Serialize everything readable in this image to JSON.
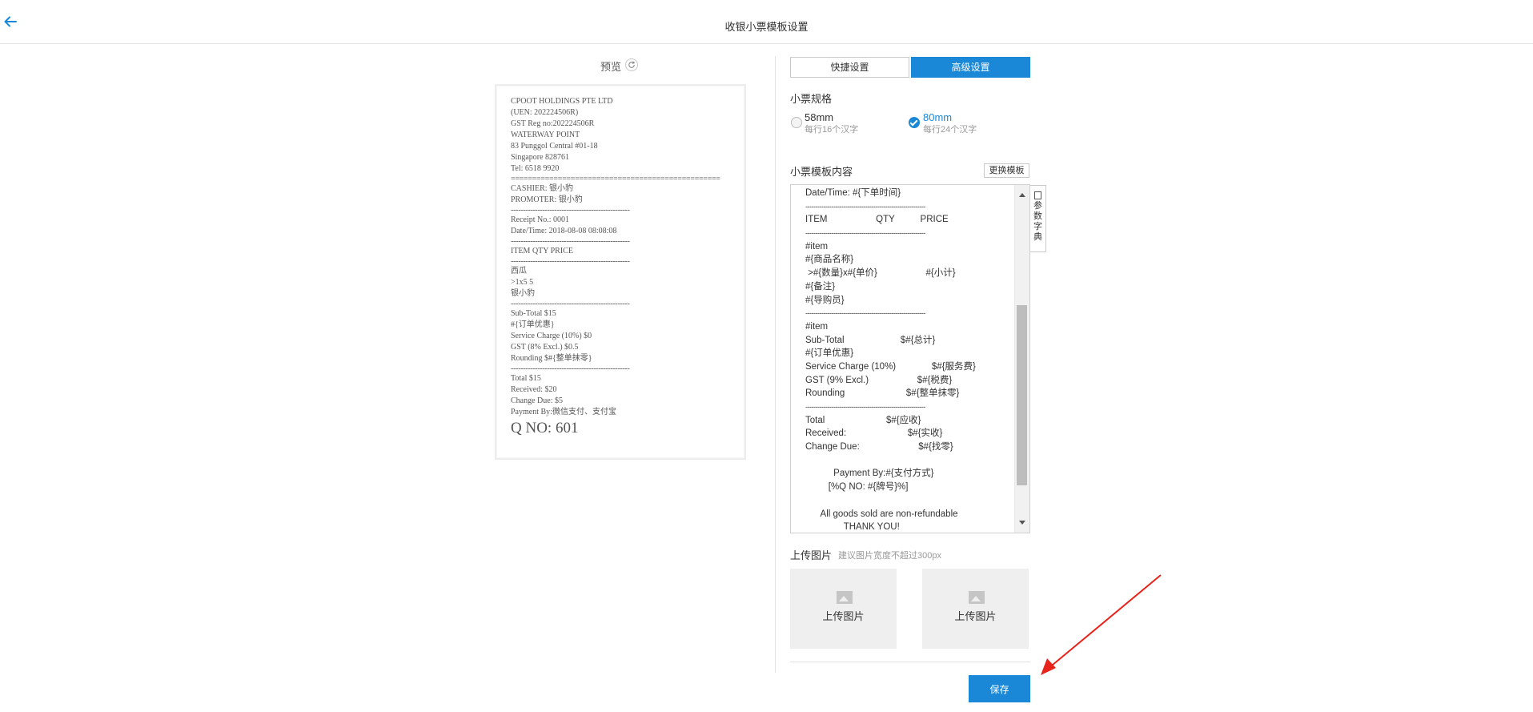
{
  "header": {
    "title": "收银小票模板设置",
    "back_icon": "arrow-left-icon",
    "accent": "#1a88d6"
  },
  "preview": {
    "label": "预览",
    "receipt": [
      {
        "text": "CPOOT HOLDINGS PTE LTD"
      },
      {
        "text": "(UEN: 202224506R)"
      },
      {
        "text": "GST Reg no:202224506R"
      },
      {
        "text": "WATERWAY POINT"
      },
      {
        "text": "83 Punggol Central #01-18"
      },
      {
        "text": "Singapore 828761"
      },
      {
        "text": "Tel: 6518 9920"
      },
      {
        "text": "=================================================",
        "sep": true
      },
      {
        "text": "CASHIER: 银小豹"
      },
      {
        "text": "PROMOTER: 银小豹"
      },
      {
        "text": "-------------------------------------------------",
        "sep": true
      },
      {
        "text": "Receipt No.: 0001"
      },
      {
        "text": "Date/Time: 2018-08-08 08:08:08"
      },
      {
        "text": "-------------------------------------------------",
        "sep": true
      },
      {
        "text": "ITEM QTY PRICE"
      },
      {
        "text": "-------------------------------------------------",
        "sep": true
      },
      {
        "text": "西瓜"
      },
      {
        "text": ">1x5 5"
      },
      {
        "text": "银小豹"
      },
      {
        "text": "-------------------------------------------------",
        "sep": true
      },
      {
        "text": "Sub-Total $15"
      },
      {
        "text": "#{订单优惠}"
      },
      {
        "text": "Service Charge (10%) $0"
      },
      {
        "text": "GST (8% Excl.) $0.5"
      },
      {
        "text": "Rounding $#{整单抹零}"
      },
      {
        "text": "-------------------------------------------------",
        "sep": true
      },
      {
        "text": "Total $15"
      },
      {
        "text": "Received: $20"
      },
      {
        "text": "Change Due: $5"
      },
      {
        "text": "Payment By:微信支付、支付宝"
      },
      {
        "text": "Q NO: 601",
        "big": true
      }
    ]
  },
  "settings": {
    "tabs": [
      {
        "label": "快捷设置",
        "active": false
      },
      {
        "label": "高级设置",
        "active": true
      }
    ],
    "spec": {
      "label": "小票规格",
      "options": [
        {
          "value": "58mm",
          "desc": "每行16个汉字",
          "selected": false
        },
        {
          "value": "80mm",
          "desc": "每行24个汉字",
          "selected": true
        }
      ]
    },
    "template": {
      "label": "小票模板内容",
      "change_button": "更换模板",
      "dictionary_tab": "参数字典",
      "lines": [
        "Date/Time: #{下单时间}",
        "------------------------------------------------------------",
        "ITEM                   QTY          PRICE",
        "------------------------------------------------------------",
        "#item",
        "#{商品名称}",
        " >#{数量}x#{单价}                   #{小计}",
        "#{备注}",
        "#{导购员}",
        "------------------------------------------------------------",
        "#item",
        "Sub-Total                      $#{总计}",
        "#{订单优惠}",
        "Service Charge (10%)              $#{服务费}",
        "GST (9% Excl.)                   $#{税费}",
        "Rounding                        $#{整单抹零}",
        "------------------------------------------------------------",
        "Total                        $#{应收}",
        "Received:                        $#{实收}",
        "Change Due:                       $#{找零}",
        "",
        "           Payment By:#{支付方式}",
        "         [%Q NO: #{牌号}%]",
        "",
        "      All goods sold are non-refundable",
        "               THANK YOU!"
      ]
    },
    "upload": {
      "label": "上传图片",
      "hint": "建议图片宽度不超过300px",
      "box1": "上传图片",
      "box2": "上传图片"
    },
    "save_button": "保存"
  }
}
